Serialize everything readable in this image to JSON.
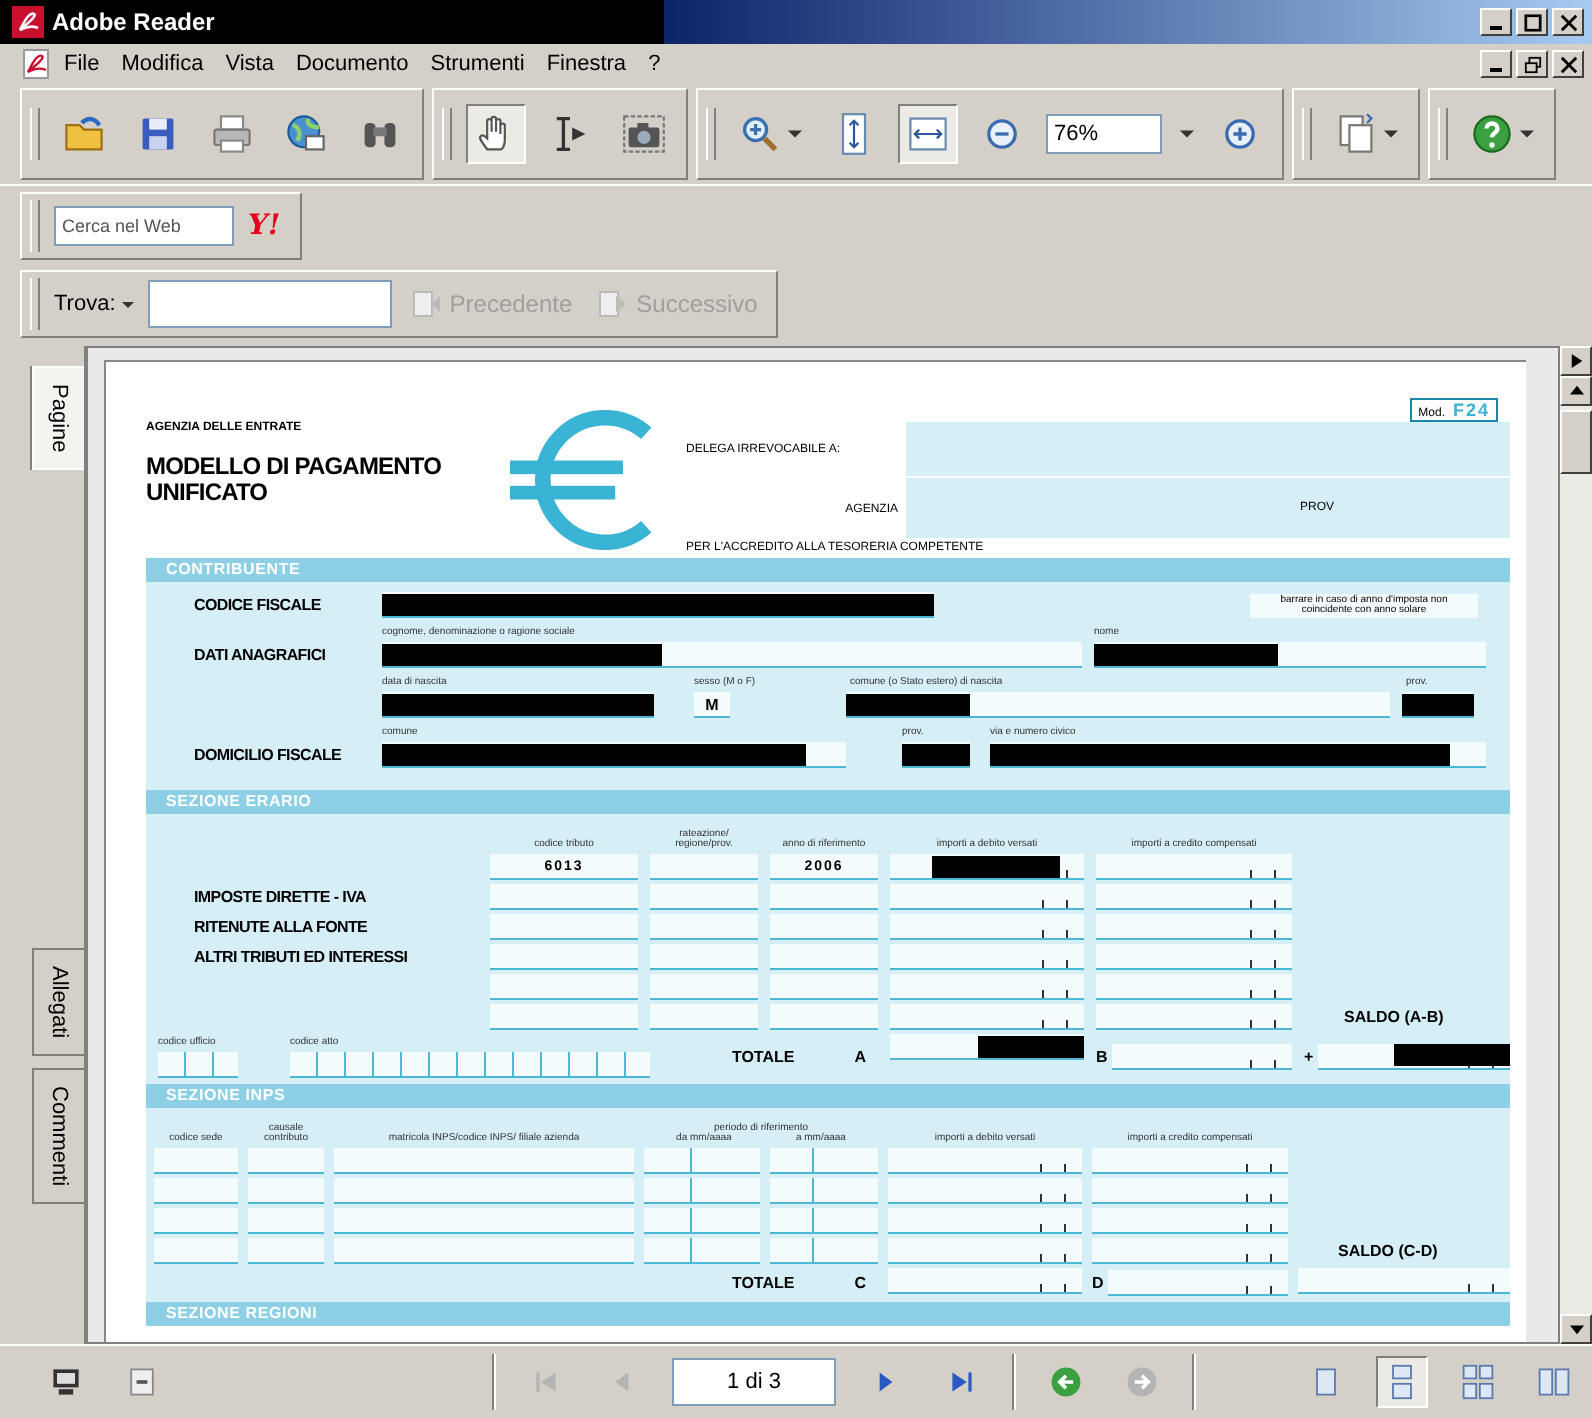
{
  "window": {
    "title": "Adobe Reader"
  },
  "menu": [
    "File",
    "Modifica",
    "Vista",
    "Documento",
    "Strumenti",
    "Finestra",
    "?"
  ],
  "toolbar": {
    "groups": [
      [
        {
          "kind": "open",
          "selected": false
        },
        {
          "kind": "save",
          "selected": false
        },
        {
          "kind": "print",
          "selected": false
        },
        {
          "kind": "email",
          "selected": false
        },
        {
          "kind": "find",
          "selected": false
        }
      ],
      [
        {
          "kind": "hand",
          "selected": true
        },
        {
          "kind": "select",
          "selected": false
        },
        {
          "kind": "snapshot",
          "selected": false
        }
      ],
      [
        {
          "kind": "zoom-in",
          "selected": false,
          "dropdown": true
        },
        {
          "kind": "fit-page",
          "selected": false
        },
        {
          "kind": "fit-width",
          "selected": true
        },
        {
          "kind": "zoom-out",
          "selected": false
        },
        {
          "kind": "zoom-field",
          "value": "76%",
          "dropdown": true
        },
        {
          "kind": "zoom-plus",
          "selected": false
        }
      ],
      [
        {
          "kind": "pages",
          "selected": false,
          "dropdown": true
        }
      ],
      [
        {
          "kind": "help",
          "selected": false,
          "dropdown": true
        }
      ]
    ]
  },
  "web_search": {
    "placeholder": "Cerca nel Web",
    "logo": "Y!"
  },
  "find": {
    "label": "Trova:",
    "buttons": [
      {
        "label": "Precedente",
        "disabled": true
      },
      {
        "label": "Successivo",
        "disabled": true
      }
    ]
  },
  "side_tabs": [
    {
      "label": "Pagine",
      "selected": true
    },
    {
      "label": "Allegati",
      "selected": false
    },
    {
      "label": "Commenti",
      "selected": false
    }
  ],
  "form": {
    "agency": "AGENZIA DELLE ENTRATE",
    "title": "MODELLO DI PAGAMENTO UNIFICATO",
    "model": {
      "label": "Mod.",
      "code": "F24"
    },
    "delega": "DELEGA IRREVOCABILE A:",
    "agenzia": "AGENZIA",
    "prov": "PROV",
    "accredito": "PER L'ACCREDITO ALLA TESORERIA COMPETENTE",
    "contribuente": {
      "heading": "CONTRIBUENTE",
      "codice_fiscale": "CODICE FISCALE",
      "note": "barrare in caso di anno d'imposta non coincidente con anno solare",
      "dati_anagrafici": "DATI ANAGRAFICI",
      "cognome_caption": "cognome, denominazione o ragione sociale",
      "nome_caption": "nome",
      "nascita_caption": "data di nascita",
      "sesso_caption": "sesso (M o F)",
      "sesso": "M",
      "comune_nascita_caption": "comune (o Stato estero) di nascita",
      "prov_nascita_caption": "prov.",
      "domicilio_fiscale": "DOMICILIO FISCALE",
      "comune_caption": "comune",
      "prov_caption": "prov.",
      "via_caption": "via e numero civico"
    },
    "erario": {
      "heading": "SEZIONE ERARIO",
      "labels": [
        "IMPOSTE DIRETTE - IVA",
        "RITENUTE ALLA FONTE",
        "ALTRI TRIBUTI ED INTERESSI"
      ],
      "columns": [
        "codice tributo",
        "rateazione/ regione/prov.",
        "anno di riferimento",
        "importi a debito versati",
        "importi a credito compensati"
      ],
      "rows": [
        {
          "codice_tributo": "6013",
          "anno": "2006",
          "debit_redacted": true
        },
        {
          "debit_redacted": false
        },
        {
          "debit_redacted": false
        },
        {
          "debit_redacted": false
        },
        {
          "debit_redacted": false
        },
        {
          "debit_redacted": false
        }
      ],
      "codice_ufficio": "codice ufficio",
      "codice_atto": "codice atto",
      "totale": "TOTALE",
      "debit_letter": "A",
      "credit_letter": "B",
      "saldo": "SALDO (A-B)",
      "saldo_sign": "+"
    },
    "inps": {
      "heading": "SEZIONE INPS",
      "columns": [
        "codice sede",
        "causale contributo",
        "matricola INPS/codice INPS/ filiale azienda",
        "da mm/aaaa",
        "a mm/aaaa",
        "importi a debito versati",
        "importi a credito compensati"
      ],
      "period_caption": "periodo di riferimento",
      "rows": [
        {
          "debit_redacted": false
        },
        {
          "debit_redacted": false
        },
        {
          "debit_redacted": false
        },
        {
          "debit_redacted": false
        }
      ],
      "totale": "TOTALE",
      "debit_letter": "C",
      "credit_letter": "D",
      "saldo": "SALDO (C-D)"
    },
    "regioni": {
      "heading": "SEZIONE REGIONI"
    }
  },
  "bottom_bar": {
    "nav": [
      {
        "kind": "first",
        "disabled": true
      },
      {
        "kind": "prev",
        "disabled": true
      },
      {
        "kind": "next",
        "disabled": false
      },
      {
        "kind": "last",
        "disabled": false
      }
    ],
    "page": "1 di 3",
    "history": [
      {
        "kind": "back",
        "disabled": false
      },
      {
        "kind": "forward",
        "disabled": true
      }
    ],
    "layouts": [
      {
        "kind": "single",
        "selected": false
      },
      {
        "kind": "continuous",
        "selected": true
      },
      {
        "kind": "continuous-facing",
        "selected": false
      },
      {
        "kind": "facing",
        "selected": false
      }
    ]
  }
}
